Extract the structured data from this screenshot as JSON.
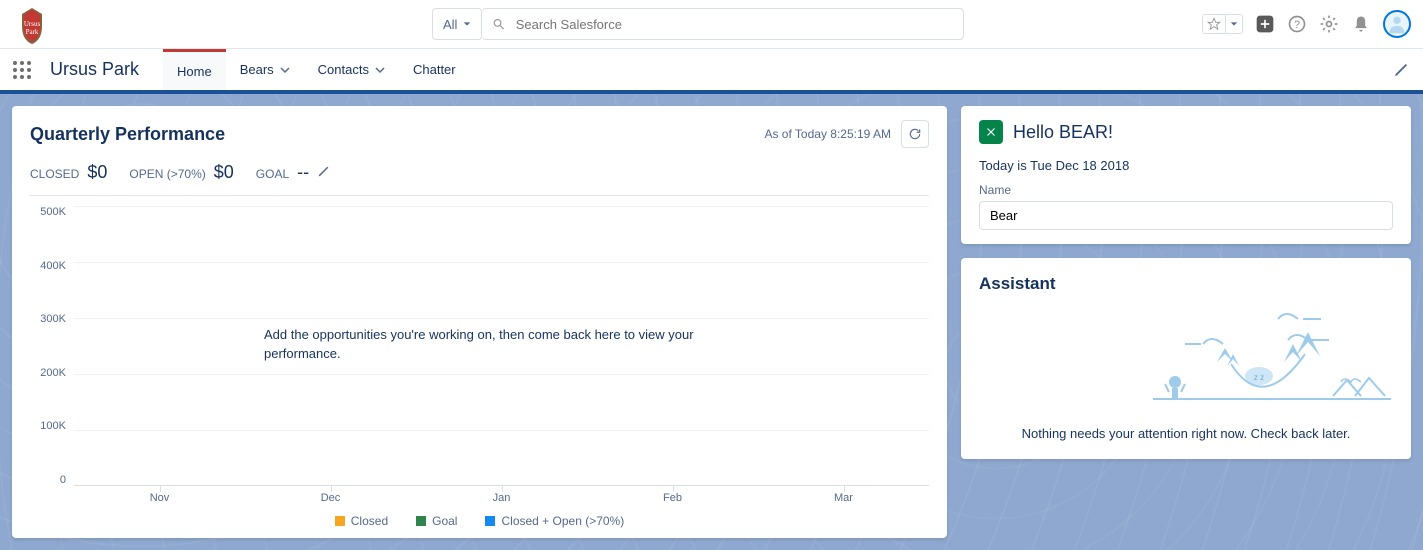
{
  "header": {
    "search_scope": "All",
    "search_placeholder": "Search Salesforce"
  },
  "nav": {
    "app_name": "Ursus Park",
    "tabs": [
      {
        "label": "Home",
        "active": true,
        "dropdown": false
      },
      {
        "label": "Bears",
        "active": false,
        "dropdown": true
      },
      {
        "label": "Contacts",
        "active": false,
        "dropdown": true
      },
      {
        "label": "Chatter",
        "active": false,
        "dropdown": false
      }
    ]
  },
  "perf": {
    "title": "Quarterly Performance",
    "as_of": "As of Today 8:25:19 AM",
    "metrics": {
      "closed_label": "CLOSED",
      "closed_value": "$0",
      "open_label": "OPEN (>70%)",
      "open_value": "$0",
      "goal_label": "GOAL",
      "goal_value": "--"
    },
    "empty_msg": "Add the opportunities you're working on, then come back here to view your performance."
  },
  "chart_data": {
    "type": "line",
    "categories": [
      "Nov",
      "Dec",
      "Jan",
      "Feb",
      "Mar"
    ],
    "series": [
      {
        "name": "Closed",
        "color": "#f5a623",
        "values": [
          null,
          null,
          null,
          null,
          null
        ]
      },
      {
        "name": "Goal",
        "color": "#2e844a",
        "values": [
          null,
          null,
          null,
          null,
          null
        ]
      },
      {
        "name": "Closed + Open (>70%)",
        "color": "#1589ee",
        "values": [
          null,
          null,
          null,
          null,
          null
        ]
      }
    ],
    "yticks": [
      "500K",
      "400K",
      "300K",
      "200K",
      "100K",
      "0"
    ],
    "ylim": [
      0,
      500000
    ],
    "xlabel": "",
    "ylabel": ""
  },
  "hello": {
    "title": "Hello BEAR!",
    "date": "Today is Tue Dec 18 2018",
    "name_label": "Name",
    "name_value": "Bear"
  },
  "assistant": {
    "title": "Assistant",
    "message": "Nothing needs your attention right now. Check back later."
  },
  "colors": {
    "closed": "#f5a623",
    "goal": "#2e844a",
    "open": "#1589ee"
  }
}
